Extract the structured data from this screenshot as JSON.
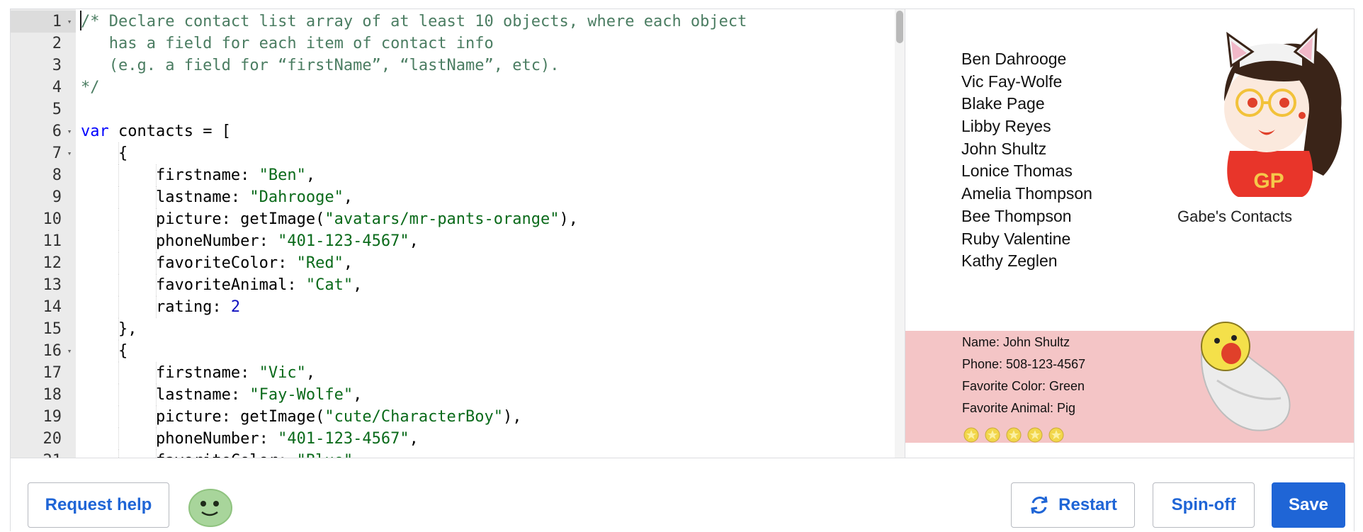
{
  "editor": {
    "lines": [
      {
        "n": "1",
        "fold": true,
        "indent": 0,
        "tokens": [
          {
            "t": "com",
            "v": "/* Declare contact list array of at least 10 objects, where each object"
          }
        ]
      },
      {
        "n": "2",
        "fold": false,
        "indent": 0,
        "tokens": [
          {
            "t": "com",
            "v": "   has a field for each item of contact info"
          }
        ]
      },
      {
        "n": "3",
        "fold": false,
        "indent": 0,
        "tokens": [
          {
            "t": "com",
            "v": "   (e.g. a field for “firstName”, “lastName”, etc)."
          }
        ]
      },
      {
        "n": "4",
        "fold": false,
        "indent": 0,
        "tokens": [
          {
            "t": "com",
            "v": "*/"
          }
        ]
      },
      {
        "n": "5",
        "fold": false,
        "indent": 0,
        "tokens": []
      },
      {
        "n": "6",
        "fold": true,
        "indent": 0,
        "tokens": [
          {
            "t": "kw",
            "v": "var"
          },
          {
            "t": "txt",
            "v": " contacts = ["
          }
        ]
      },
      {
        "n": "7",
        "fold": true,
        "indent": 1,
        "tokens": [
          {
            "t": "txt",
            "v": "    {"
          }
        ]
      },
      {
        "n": "8",
        "fold": false,
        "indent": 2,
        "tokens": [
          {
            "t": "txt",
            "v": "        firstname: "
          },
          {
            "t": "str",
            "v": "\"Ben\""
          },
          {
            "t": "txt",
            "v": ","
          }
        ]
      },
      {
        "n": "9",
        "fold": false,
        "indent": 2,
        "tokens": [
          {
            "t": "txt",
            "v": "        lastname: "
          },
          {
            "t": "str",
            "v": "\"Dahrooge\""
          },
          {
            "t": "txt",
            "v": ","
          }
        ]
      },
      {
        "n": "10",
        "fold": false,
        "indent": 2,
        "tokens": [
          {
            "t": "txt",
            "v": "        picture: getImage("
          },
          {
            "t": "str",
            "v": "\"avatars/mr-pants-orange\""
          },
          {
            "t": "txt",
            "v": "),"
          }
        ]
      },
      {
        "n": "11",
        "fold": false,
        "indent": 2,
        "tokens": [
          {
            "t": "txt",
            "v": "        phoneNumber: "
          },
          {
            "t": "str",
            "v": "\"401-123-4567\""
          },
          {
            "t": "txt",
            "v": ","
          }
        ]
      },
      {
        "n": "12",
        "fold": false,
        "indent": 2,
        "tokens": [
          {
            "t": "txt",
            "v": "        favoriteColor: "
          },
          {
            "t": "str",
            "v": "\"Red\""
          },
          {
            "t": "txt",
            "v": ","
          }
        ]
      },
      {
        "n": "13",
        "fold": false,
        "indent": 2,
        "tokens": [
          {
            "t": "txt",
            "v": "        favoriteAnimal: "
          },
          {
            "t": "str",
            "v": "\"Cat\""
          },
          {
            "t": "txt",
            "v": ","
          }
        ]
      },
      {
        "n": "14",
        "fold": false,
        "indent": 2,
        "tokens": [
          {
            "t": "txt",
            "v": "        rating: "
          },
          {
            "t": "num",
            "v": "2"
          }
        ]
      },
      {
        "n": "15",
        "fold": false,
        "indent": 1,
        "tokens": [
          {
            "t": "txt",
            "v": "    },"
          }
        ]
      },
      {
        "n": "16",
        "fold": true,
        "indent": 1,
        "tokens": [
          {
            "t": "txt",
            "v": "    {"
          }
        ]
      },
      {
        "n": "17",
        "fold": false,
        "indent": 2,
        "tokens": [
          {
            "t": "txt",
            "v": "        firstname: "
          },
          {
            "t": "str",
            "v": "\"Vic\""
          },
          {
            "t": "txt",
            "v": ","
          }
        ]
      },
      {
        "n": "18",
        "fold": false,
        "indent": 2,
        "tokens": [
          {
            "t": "txt",
            "v": "        lastname: "
          },
          {
            "t": "str",
            "v": "\"Fay-Wolfe\""
          },
          {
            "t": "txt",
            "v": ","
          }
        ]
      },
      {
        "n": "19",
        "fold": false,
        "indent": 2,
        "tokens": [
          {
            "t": "txt",
            "v": "        picture: getImage("
          },
          {
            "t": "str",
            "v": "\"cute/CharacterBoy\""
          },
          {
            "t": "txt",
            "v": "),"
          }
        ]
      },
      {
        "n": "20",
        "fold": false,
        "indent": 2,
        "tokens": [
          {
            "t": "txt",
            "v": "        phoneNumber: "
          },
          {
            "t": "str",
            "v": "\"401-123-4567\""
          },
          {
            "t": "txt",
            "v": ","
          }
        ]
      },
      {
        "n": "21",
        "fold": false,
        "indent": 2,
        "tokens": [
          {
            "t": "txt",
            "v": "        favoriteColor: "
          },
          {
            "t": "str",
            "v": "\"Blue\""
          },
          {
            "t": "txt",
            "v": ","
          }
        ]
      }
    ]
  },
  "output": {
    "contacts": [
      "Ben Dahrooge",
      "Vic Fay-Wolfe",
      "Blake Page",
      "Libby Reyes",
      "John Shultz",
      "Lonice Thomas",
      "Amelia Thompson",
      "Bee Thompson",
      "Ruby Valentine",
      "Kathy Zeglen"
    ],
    "owner_title": "Gabe's Contacts",
    "avatar_badge": "GP",
    "selected": {
      "name": "Name: John Shultz",
      "phone": "Phone: 508-123-4567",
      "color": "Favorite Color: Green",
      "animal": "Favorite Animal: Pig",
      "rating": 5
    },
    "detail_bg": "#f4c5c6"
  },
  "toolbar": {
    "help_label": "Request help",
    "restart_label": "Restart",
    "spinoff_label": "Spin-off",
    "save_label": "Save",
    "accent": "#1f65d6"
  }
}
